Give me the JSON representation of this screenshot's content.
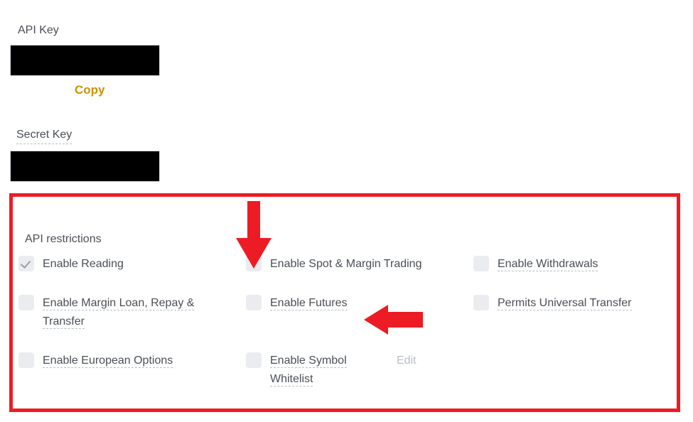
{
  "page": {
    "background": "#ffffff",
    "accent_gold": "#c99400",
    "annotation_red": "#ed1c24"
  },
  "api_key_field": {
    "label": "API Key",
    "value_masked": "",
    "copy_label": "Copy"
  },
  "secret_key_field": {
    "label": "Secret Key",
    "value_masked": ""
  },
  "restrictions": {
    "title": "API restrictions",
    "edit_label": "Edit",
    "rows": [
      {
        "col1": {
          "label": "Enable Reading",
          "checked": true,
          "underlined": false
        },
        "col2": {
          "label": "Enable Spot & Margin Trading",
          "checked": false,
          "underlined": false
        },
        "col3": {
          "label": "Enable Withdrawals",
          "checked": false,
          "underlined": true
        }
      },
      {
        "col1": {
          "label": "Enable Margin Loan, Repay & Transfer",
          "checked": false,
          "underlined": true
        },
        "col2": {
          "label": "Enable Futures",
          "checked": false,
          "underlined": true
        },
        "col3": {
          "label": "Permits Universal Transfer",
          "checked": false,
          "underlined": true
        }
      },
      {
        "col1": {
          "label": "Enable European Options",
          "checked": false,
          "underlined": true
        },
        "col2": {
          "label": "Enable Symbol Whitelist",
          "checked": false,
          "underlined": true
        },
        "col3": {
          "label": "",
          "checked": false,
          "underlined": false
        }
      }
    ]
  },
  "annotations": {
    "arrow_down": "down-arrow-pointing-at-enable-spot-margin-trading",
    "arrow_left": "left-arrow-pointing-at-enable-futures",
    "highlight_box": "red-rectangle-around-api-restrictions"
  }
}
